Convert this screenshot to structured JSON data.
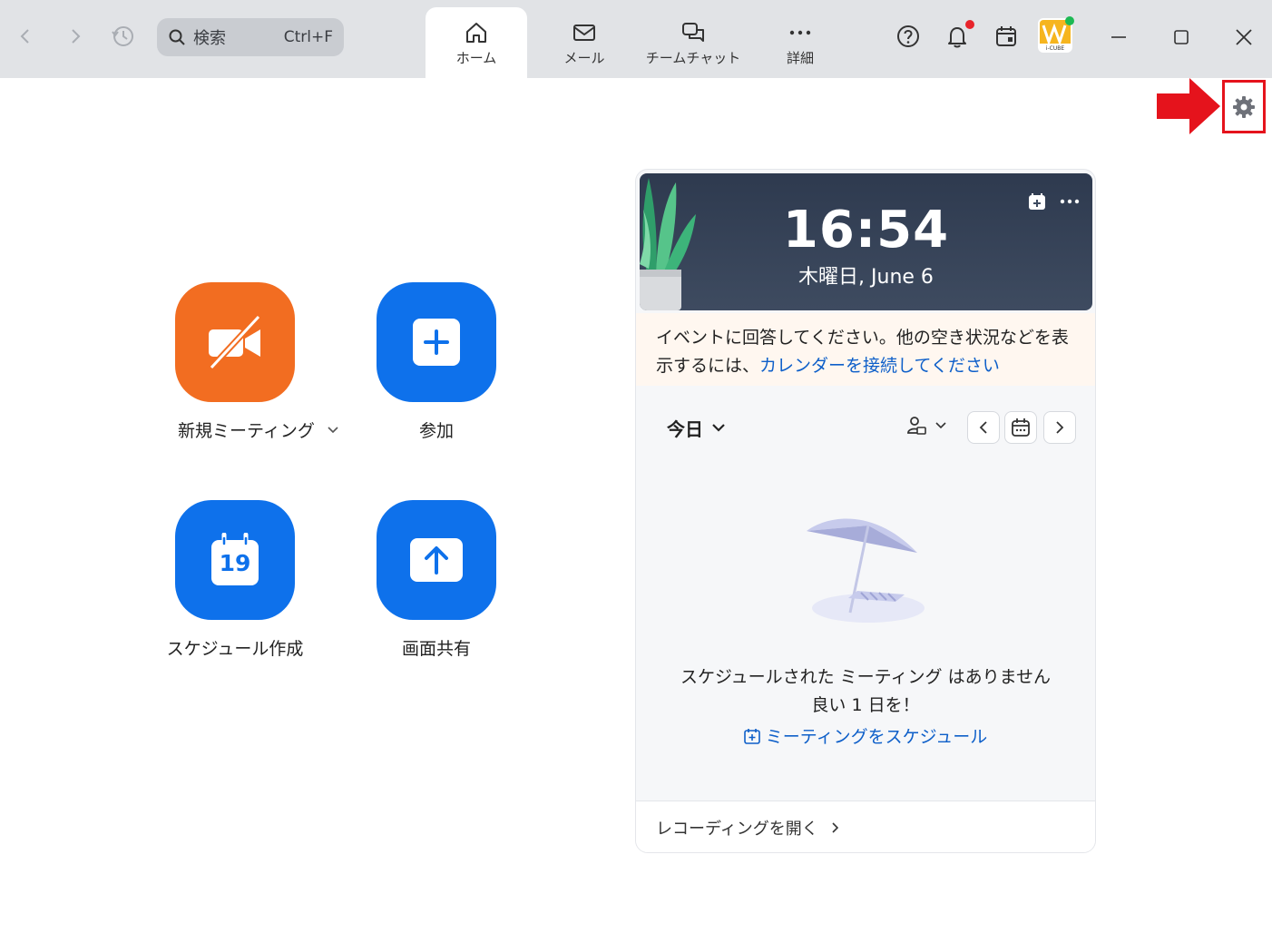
{
  "titlebar": {
    "search": {
      "placeholder": "検索",
      "shortcut": "Ctrl+F"
    },
    "tabs": [
      {
        "label": "ホーム",
        "icon": "home-icon",
        "active": true
      },
      {
        "label": "メール",
        "icon": "mail-icon",
        "active": false
      },
      {
        "label": "チームチャット",
        "icon": "chat-icon",
        "active": false
      },
      {
        "label": "詳細",
        "icon": "more-icon",
        "active": false
      }
    ],
    "avatar_text": "i-CUBE",
    "colors": {
      "bar": "#e1e3e6",
      "notification_dot": "#e8242b",
      "presence_dot": "#1db954"
    }
  },
  "actions": {
    "new_meeting": "新規ミーティング",
    "join": "参加",
    "schedule": "スケジュール作成",
    "schedule_day": "19",
    "share_screen": "画面共有"
  },
  "calendar": {
    "time": "16:54",
    "date": "木曜日, June 6",
    "notice_text": "イベントに回答してください。他の空き状況などを表示するには、",
    "notice_link": "カレンダーを接続してください",
    "today_label": "今日",
    "empty_title": "スケジュールされた ミーティング はありません",
    "empty_subtitle": "良い 1 日を！",
    "schedule_link": "ミーティングをスケジュール",
    "recordings_link": "レコーディングを開く"
  },
  "colors": {
    "accent_blue": "#0e71eb",
    "accent_orange": "#f26d21",
    "highlight_red": "#e5131c",
    "link": "#0e5fc9"
  }
}
